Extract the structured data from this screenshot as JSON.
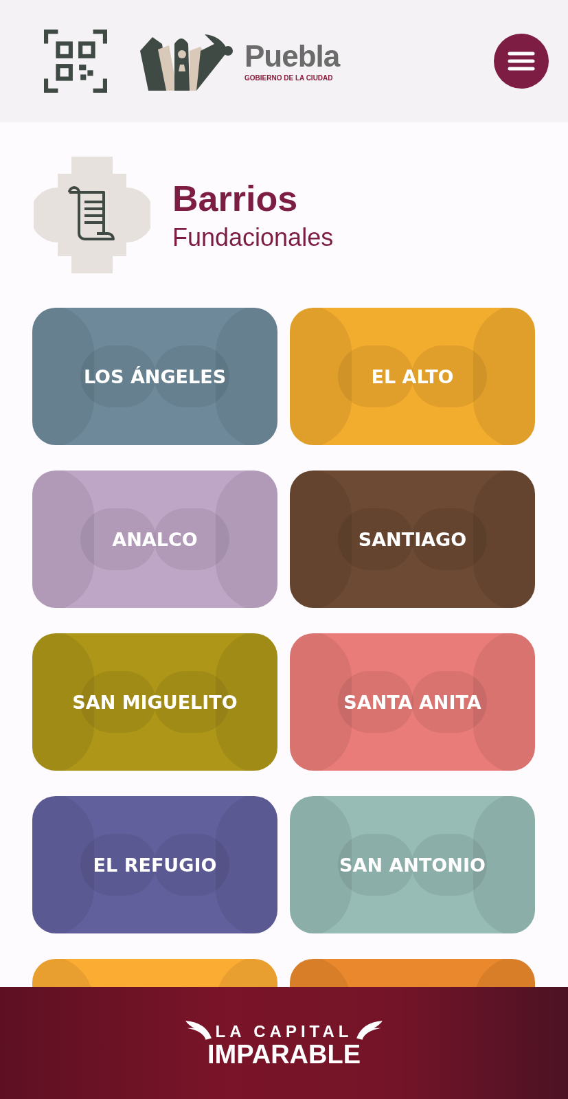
{
  "header": {
    "logo_name": "Puebla",
    "logo_subtitle": "GOBIERNO DE LA CIUDAD"
  },
  "section": {
    "title": "Barrios",
    "subtitle": "Fundacionales"
  },
  "tiles": [
    {
      "label": "LOS ÁNGELES",
      "color": "#6e8a9a"
    },
    {
      "label": "EL ALTO",
      "color": "#f2ac2e"
    },
    {
      "label": "ANALCO",
      "color": "#bea6c6"
    },
    {
      "label": "SANTIAGO",
      "color": "#6c4a33"
    },
    {
      "label": "SAN MIGUELITO",
      "color": "#ae9619"
    },
    {
      "label": "SANTA ANITA",
      "color": "#e97c78"
    },
    {
      "label": "EL REFUGIO",
      "color": "#62609c"
    },
    {
      "label": "SAN ANTONIO",
      "color": "#97bcb5"
    },
    {
      "color": "#fbac33"
    },
    {
      "color": "#e9882c"
    }
  ],
  "footer": {
    "line_1": "LA CAPITAL",
    "line_2": "IMPARABLE"
  }
}
